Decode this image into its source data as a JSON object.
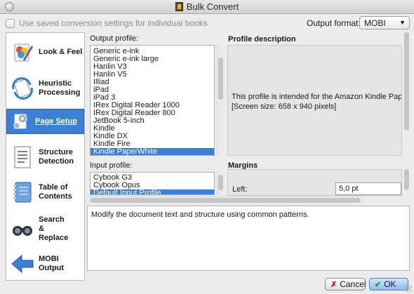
{
  "window": {
    "title": "Bulk Convert",
    "app_icon": "calibre-book-icon"
  },
  "top": {
    "checkbox_label": "Use saved conversion settings for individual books",
    "checkbox_checked": false,
    "output_format_label": "Output format:",
    "output_format_value": "MOBI"
  },
  "sidebar": {
    "items": [
      {
        "label_1": "Look & Feel",
        "label_2": "",
        "icon": "look-and-feel-icon",
        "selected": false
      },
      {
        "label_1": "Heuristic",
        "label_2": "Processing",
        "icon": "heuristic-processing-icon",
        "selected": false
      },
      {
        "label_1": "Page Setup",
        "label_2": "",
        "icon": "page-setup-icon",
        "selected": true
      },
      {
        "label_1": "Structure",
        "label_2": "Detection",
        "icon": "structure-detection-icon",
        "selected": false
      },
      {
        "label_1": "Table of",
        "label_2": "Contents",
        "icon": "table-of-contents-icon",
        "selected": false
      },
      {
        "label_1": "Search",
        "label_2": "&",
        "label_3": "Replace",
        "icon": "search-replace-icon",
        "selected": false
      },
      {
        "label_1": "MOBI Output",
        "label_2": "",
        "icon": "mobi-output-icon",
        "selected": false
      }
    ]
  },
  "output_profile": {
    "label": "Output profile:",
    "items": [
      "Generic e-ink",
      "Generic e-ink large",
      "Hanlin V3",
      "Hanlin V5",
      "Illiad",
      "iPad",
      "iPad 3",
      "IRex Digital Reader 1000",
      "IRex Digital Reader 800",
      "JetBook 5-inch",
      "Kindle",
      "Kindle DX",
      "Kindle Fire",
      "Kindle PaperWhite"
    ],
    "selected": "Kindle PaperWhite"
  },
  "input_profile": {
    "label": "Input profile:",
    "items": [
      "Cybook G3",
      "Cybook Opus",
      "Default Input Profile"
    ],
    "selected": "Default Input Profile"
  },
  "profile_description": {
    "heading": "Profile description",
    "line_1": "This profile is intended for the Amazon Kindle Pape",
    "line_2": "[Screen size: 658 x 940 pixels]"
  },
  "margins": {
    "heading": "Margins",
    "left_label": "Left:",
    "left_value": "5,0 pt"
  },
  "help_text": "Modify the document text and structure using common patterns.",
  "buttons": {
    "cancel": "Cancel",
    "ok": "OK",
    "cancel_icon": "✗",
    "ok_icon": "✔"
  }
}
